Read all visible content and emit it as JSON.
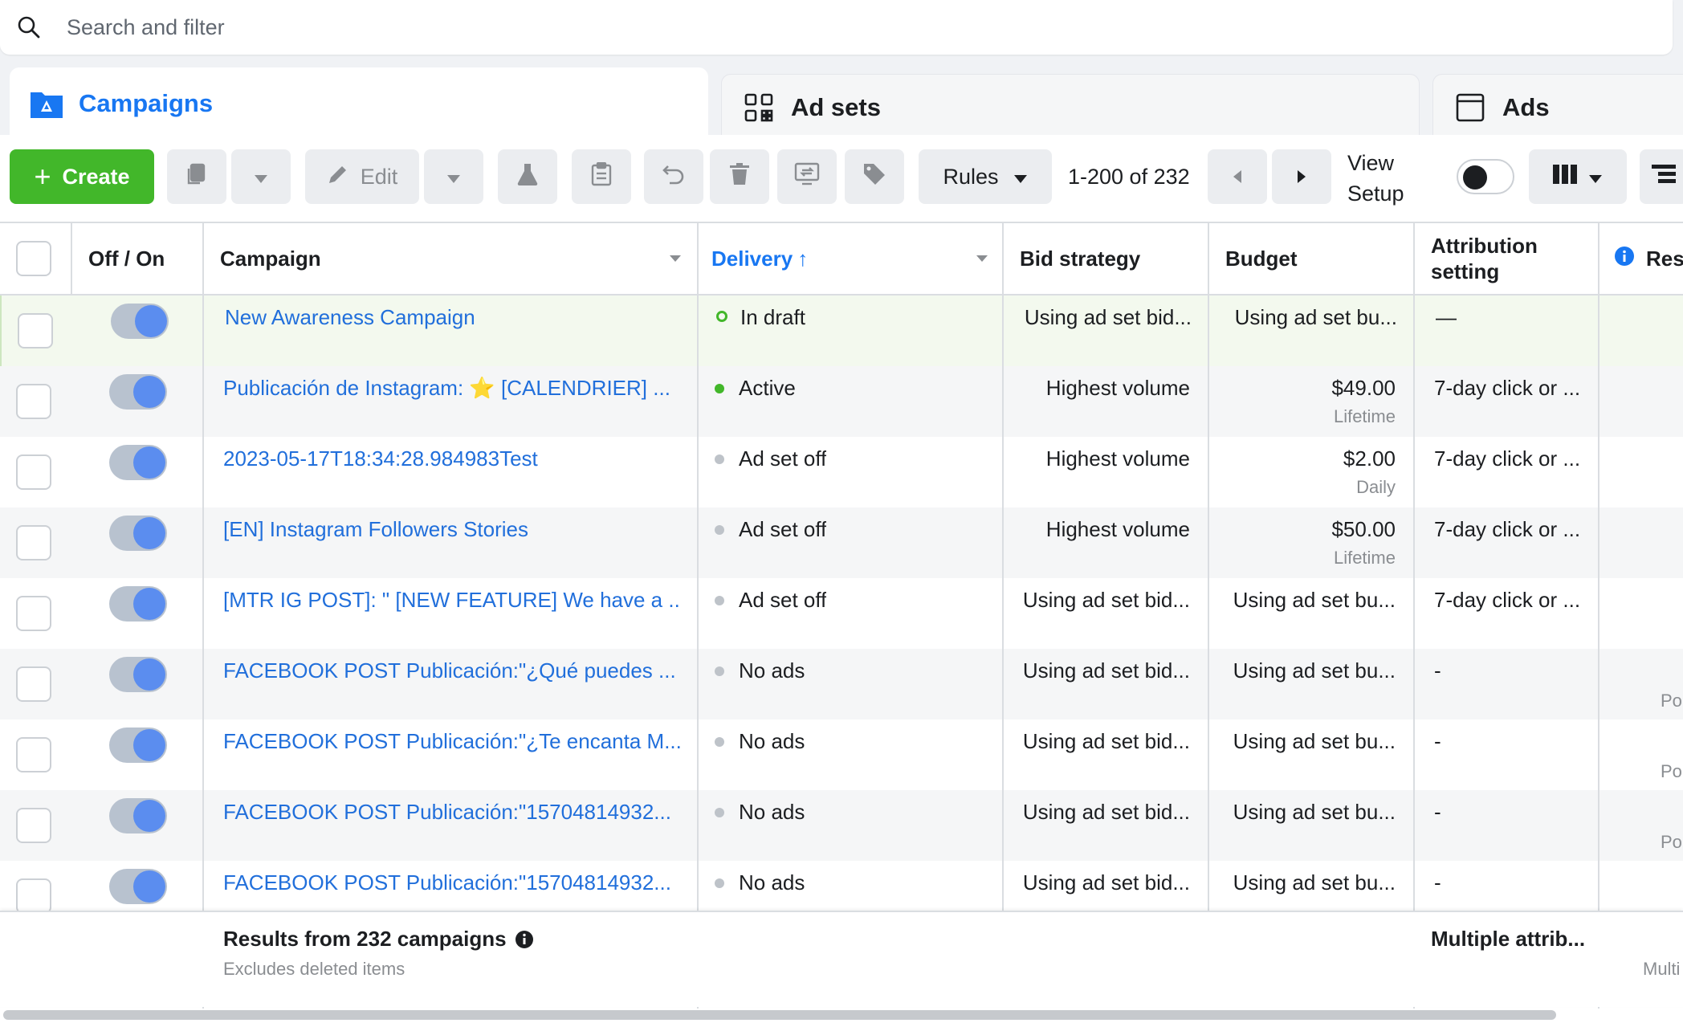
{
  "search": {
    "placeholder": "Search and filter"
  },
  "tabs": [
    {
      "label": "Campaigns",
      "icon": "campaign-folder-icon",
      "active": true
    },
    {
      "label": "Ad sets",
      "icon": "grid-icon",
      "active": false
    },
    {
      "label": "Ads",
      "icon": "ad-window-icon",
      "active": false
    }
  ],
  "toolbar": {
    "create_label": "Create",
    "edit_label": "Edit",
    "rules_label": "Rules",
    "pagination": "1-200 of 232",
    "view_setup_line1": "View",
    "view_setup_line2": "Setup"
  },
  "columns": {
    "off_on": "Off / On",
    "campaign": "Campaign",
    "delivery": "Delivery",
    "delivery_sort_arrow": "↑",
    "bid_strategy": "Bid strategy",
    "budget": "Budget",
    "attribution_line1": "Attribution",
    "attribution_line2": "setting",
    "results_partial": "Res"
  },
  "rows": [
    {
      "campaign": "New Awareness Campaign",
      "delivery": "In draft",
      "status": "draft",
      "bid": "Using ad set bid...",
      "budget": "Using ad set bu...",
      "budget_sub": "",
      "attribution": "—",
      "result_partial": ""
    },
    {
      "campaign": "Publicación de Instagram: ⭐️ [CALENDRIER] ...",
      "delivery": "Active",
      "status": "active",
      "bid": "Highest volume",
      "budget": "$49.00",
      "budget_sub": "Lifetime",
      "attribution": "7-day click or ...",
      "result_partial": ""
    },
    {
      "campaign": "2023-05-17T18:34:28.984983Test",
      "delivery": "Ad set off",
      "status": "off",
      "bid": "Highest volume",
      "budget": "$2.00",
      "budget_sub": "Daily",
      "attribution": "7-day click or ...",
      "result_partial": ""
    },
    {
      "campaign": "[EN] Instagram Followers Stories",
      "delivery": "Ad set off",
      "status": "off",
      "bid": "Highest volume",
      "budget": "$50.00",
      "budget_sub": "Lifetime",
      "attribution": "7-day click or ...",
      "result_partial": ""
    },
    {
      "campaign": "[MTR IG POST]: \" [NEW FEATURE]  We have a ...",
      "delivery": "Ad set off",
      "status": "off",
      "bid": "Using ad set bid...",
      "budget": "Using ad set bu...",
      "budget_sub": "",
      "attribution": "7-day click or ...",
      "result_partial": ""
    },
    {
      "campaign": "FACEBOOK POST Publicación:\"¿Qué puedes ...",
      "delivery": "No ads",
      "status": "off",
      "bid": "Using ad set bid...",
      "budget": "Using ad set bu...",
      "budget_sub": "",
      "attribution": "-",
      "result_partial": "Po"
    },
    {
      "campaign": "FACEBOOK POST Publicación:\"¿Te encanta M...",
      "delivery": "No ads",
      "status": "off",
      "bid": "Using ad set bid...",
      "budget": "Using ad set bu...",
      "budget_sub": "",
      "attribution": "-",
      "result_partial": "Po"
    },
    {
      "campaign": "FACEBOOK POST Publicación:\"15704814932...",
      "delivery": "No ads",
      "status": "off",
      "bid": "Using ad set bid...",
      "budget": "Using ad set bu...",
      "budget_sub": "",
      "attribution": "-",
      "result_partial": "Po"
    },
    {
      "campaign": "FACEBOOK POST Publicación:\"15704814932...",
      "delivery": "No ads",
      "status": "off",
      "bid": "Using ad set bid...",
      "budget": "Using ad set bu...",
      "budget_sub": "",
      "attribution": "-",
      "result_partial": ""
    }
  ],
  "footer": {
    "results_label": "Results from 232 campaigns",
    "excludes_label": "Excludes deleted items",
    "attribution_summary": "Multiple attrib...",
    "results_partial": "Multi"
  },
  "colors": {
    "brand_blue": "#1877f2",
    "link_blue": "#216fdb",
    "create_green": "#42b72a",
    "active_dot": "#42b72a",
    "inactive_dot": "#bec3c9"
  }
}
